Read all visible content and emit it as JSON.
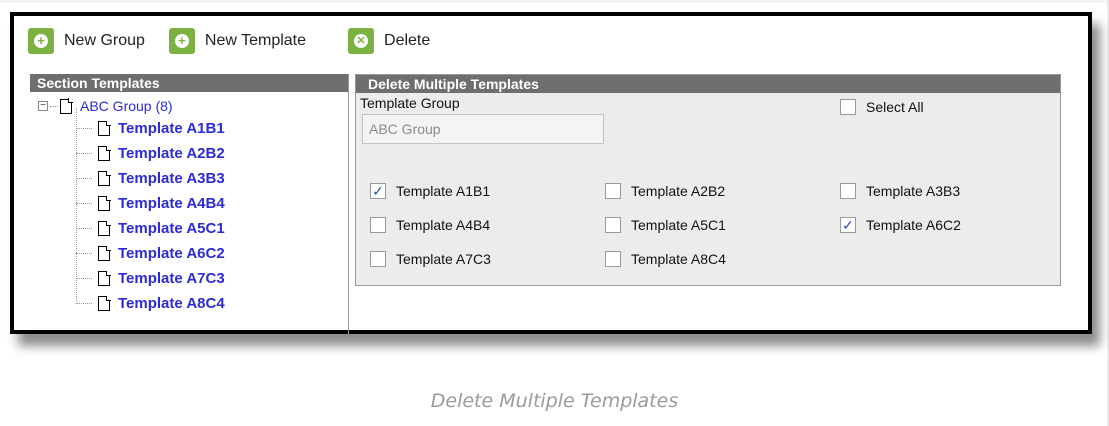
{
  "toolbar": {
    "new_group_label": "New Group",
    "new_template_label": "New Template",
    "delete_label": "Delete"
  },
  "section_templates": {
    "header": "Section Templates",
    "root_label": "ABC Group (8)",
    "items": [
      {
        "label": "Template A1B1"
      },
      {
        "label": "Template A2B2"
      },
      {
        "label": "Template A3B3"
      },
      {
        "label": "Template A4B4"
      },
      {
        "label": "Template A5C1"
      },
      {
        "label": "Template A6C2"
      },
      {
        "label": "Template A7C3"
      },
      {
        "label": "Template A8C4"
      }
    ]
  },
  "delete_panel": {
    "header": "Delete Multiple Templates",
    "template_group_label": "Template Group",
    "template_group_value": "ABC Group",
    "select_all_label": "Select All",
    "select_all_checked": false,
    "templates": [
      {
        "label": "Template A1B1",
        "checked": true
      },
      {
        "label": "Template A2B2",
        "checked": false
      },
      {
        "label": "Template A3B3",
        "checked": false
      },
      {
        "label": "Template A4B4",
        "checked": false
      },
      {
        "label": "Template A5C1",
        "checked": false
      },
      {
        "label": "Template A6C2",
        "checked": true
      },
      {
        "label": "Template A7C3",
        "checked": false
      },
      {
        "label": "Template A8C4",
        "checked": false
      }
    ]
  },
  "caption": "Delete Multiple Templates",
  "colors": {
    "accent_green": "#7bb241",
    "link_blue": "#2b2bd8",
    "header_gray": "#6e6e6e"
  },
  "icons": {
    "new_group": "plus-circle-icon",
    "new_template": "plus-circle-icon",
    "delete": "x-circle-icon"
  }
}
